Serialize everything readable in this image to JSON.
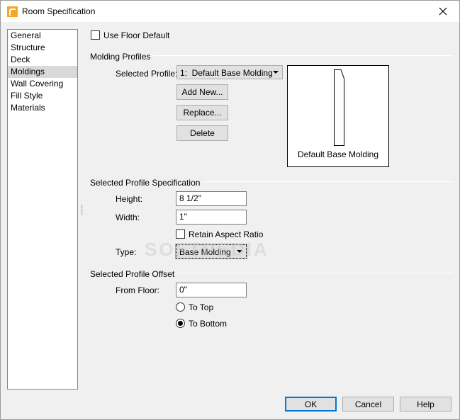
{
  "window": {
    "title": "Room Specification"
  },
  "nav": {
    "items": [
      {
        "label": "General"
      },
      {
        "label": "Structure"
      },
      {
        "label": "Deck"
      },
      {
        "label": "Moldings"
      },
      {
        "label": "Wall Covering"
      },
      {
        "label": "Fill Style"
      },
      {
        "label": "Materials"
      }
    ],
    "selected_index": 3
  },
  "use_floor_default": {
    "label": "Use Floor Default",
    "checked": false
  },
  "molding_profiles": {
    "group_label": "Molding Profiles",
    "selected_profile_label": "Selected Profile:",
    "selected_profile_value": "1:  Default Base Molding",
    "add_new_label": "Add New...",
    "replace_label": "Replace...",
    "delete_label": "Delete",
    "preview_caption": "Default Base Molding"
  },
  "profile_spec": {
    "group_label": "Selected Profile Specification",
    "height_label": "Height:",
    "height_value": "8 1/2\"",
    "width_label": "Width:",
    "width_value": "1\"",
    "retain_aspect_label": "Retain Aspect Ratio",
    "retain_aspect_checked": false,
    "type_label": "Type:",
    "type_value": "Base Molding"
  },
  "profile_offset": {
    "group_label": "Selected Profile Offset",
    "from_floor_label": "From Floor:",
    "from_floor_value": "0\"",
    "to_top_label": "To Top",
    "to_bottom_label": "To Bottom",
    "selected": "To Bottom"
  },
  "footer": {
    "ok_label": "OK",
    "cancel_label": "Cancel",
    "help_label": "Help"
  },
  "watermark": "SOFTPEDIA",
  "colors": {
    "accent": "#0078d7",
    "icon_orange": "#f5a623"
  }
}
